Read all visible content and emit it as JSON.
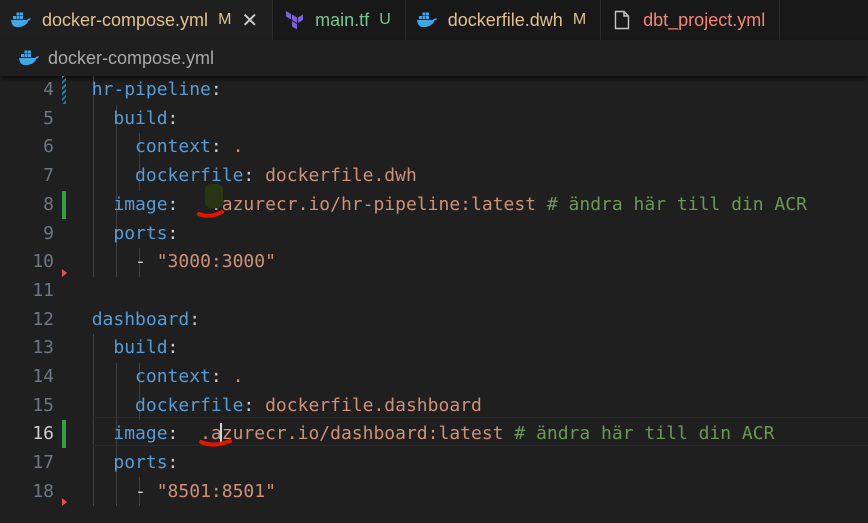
{
  "tabs": [
    {
      "label": "docker-compose.yml",
      "status": "M",
      "icon": "docker-icon",
      "active": true
    },
    {
      "label": "main.tf",
      "status": "U",
      "icon": "terraform-icon"
    },
    {
      "label": "dockerfile.dwh",
      "status": "M",
      "icon": "docker-icon"
    },
    {
      "label": "dbt_project.yml",
      "status": "",
      "icon": "file-icon"
    }
  ],
  "breadcrumb": {
    "file": "docker-compose.yml"
  },
  "editor": {
    "current_line": 16,
    "lines": [
      {
        "num": "4",
        "indent": "  ",
        "key": "hr-pipeline",
        "sep": ":",
        "value": "",
        "comment": ""
      },
      {
        "num": "5",
        "indent": "    ",
        "key": "build",
        "sep": ":",
        "value": "",
        "comment": ""
      },
      {
        "num": "6",
        "indent": "      ",
        "key": "context",
        "sep": ": ",
        "value": ".",
        "comment": ""
      },
      {
        "num": "7",
        "indent": "      ",
        "key": "dockerfile",
        "sep": ": ",
        "value": "dockerfile.dwh",
        "comment": ""
      },
      {
        "num": "8",
        "indent": "    ",
        "key": "image",
        "sep": ": ",
        "value": "  .azurecr.io/hr-pipeline:latest",
        "comment": " # ändra här till din ACR"
      },
      {
        "num": "9",
        "indent": "    ",
        "key": "ports",
        "sep": ":",
        "value": "",
        "comment": ""
      },
      {
        "num": "10",
        "indent": "      ",
        "key": "",
        "sep": "- ",
        "value": "\"3000:3000\"",
        "comment": ""
      },
      {
        "num": "11",
        "indent": "",
        "key": "",
        "sep": "",
        "value": "",
        "comment": ""
      },
      {
        "num": "12",
        "indent": "  ",
        "key": "dashboard",
        "sep": ":",
        "value": "",
        "comment": ""
      },
      {
        "num": "13",
        "indent": "    ",
        "key": "build",
        "sep": ":",
        "value": "",
        "comment": ""
      },
      {
        "num": "14",
        "indent": "      ",
        "key": "context",
        "sep": ": ",
        "value": ".",
        "comment": ""
      },
      {
        "num": "15",
        "indent": "      ",
        "key": "dockerfile",
        "sep": ": ",
        "value": "dockerfile.dashboard",
        "comment": ""
      },
      {
        "num": "16",
        "indent": "    ",
        "key": "image",
        "sep": ": ",
        "value": " .azurecr.io/dashboard:latest",
        "comment": " # ändra här till din ACR"
      },
      {
        "num": "17",
        "indent": "    ",
        "key": "ports",
        "sep": ":",
        "value": "",
        "comment": ""
      },
      {
        "num": "18",
        "indent": "      ",
        "key": "",
        "sep": "- ",
        "value": "\"8501:8501\"",
        "comment": ""
      }
    ]
  },
  "colors": {
    "background": "#1f1f1f",
    "key": "#569cd6",
    "string": "#ce9178",
    "comment": "#6a9955",
    "modified": "#e2c08d",
    "untracked": "#73c991",
    "gutter_added": "#2ea043",
    "gutter_modified": "#1b81a8",
    "gutter_deleted": "#f14c4c",
    "annotation": "#e51400"
  }
}
